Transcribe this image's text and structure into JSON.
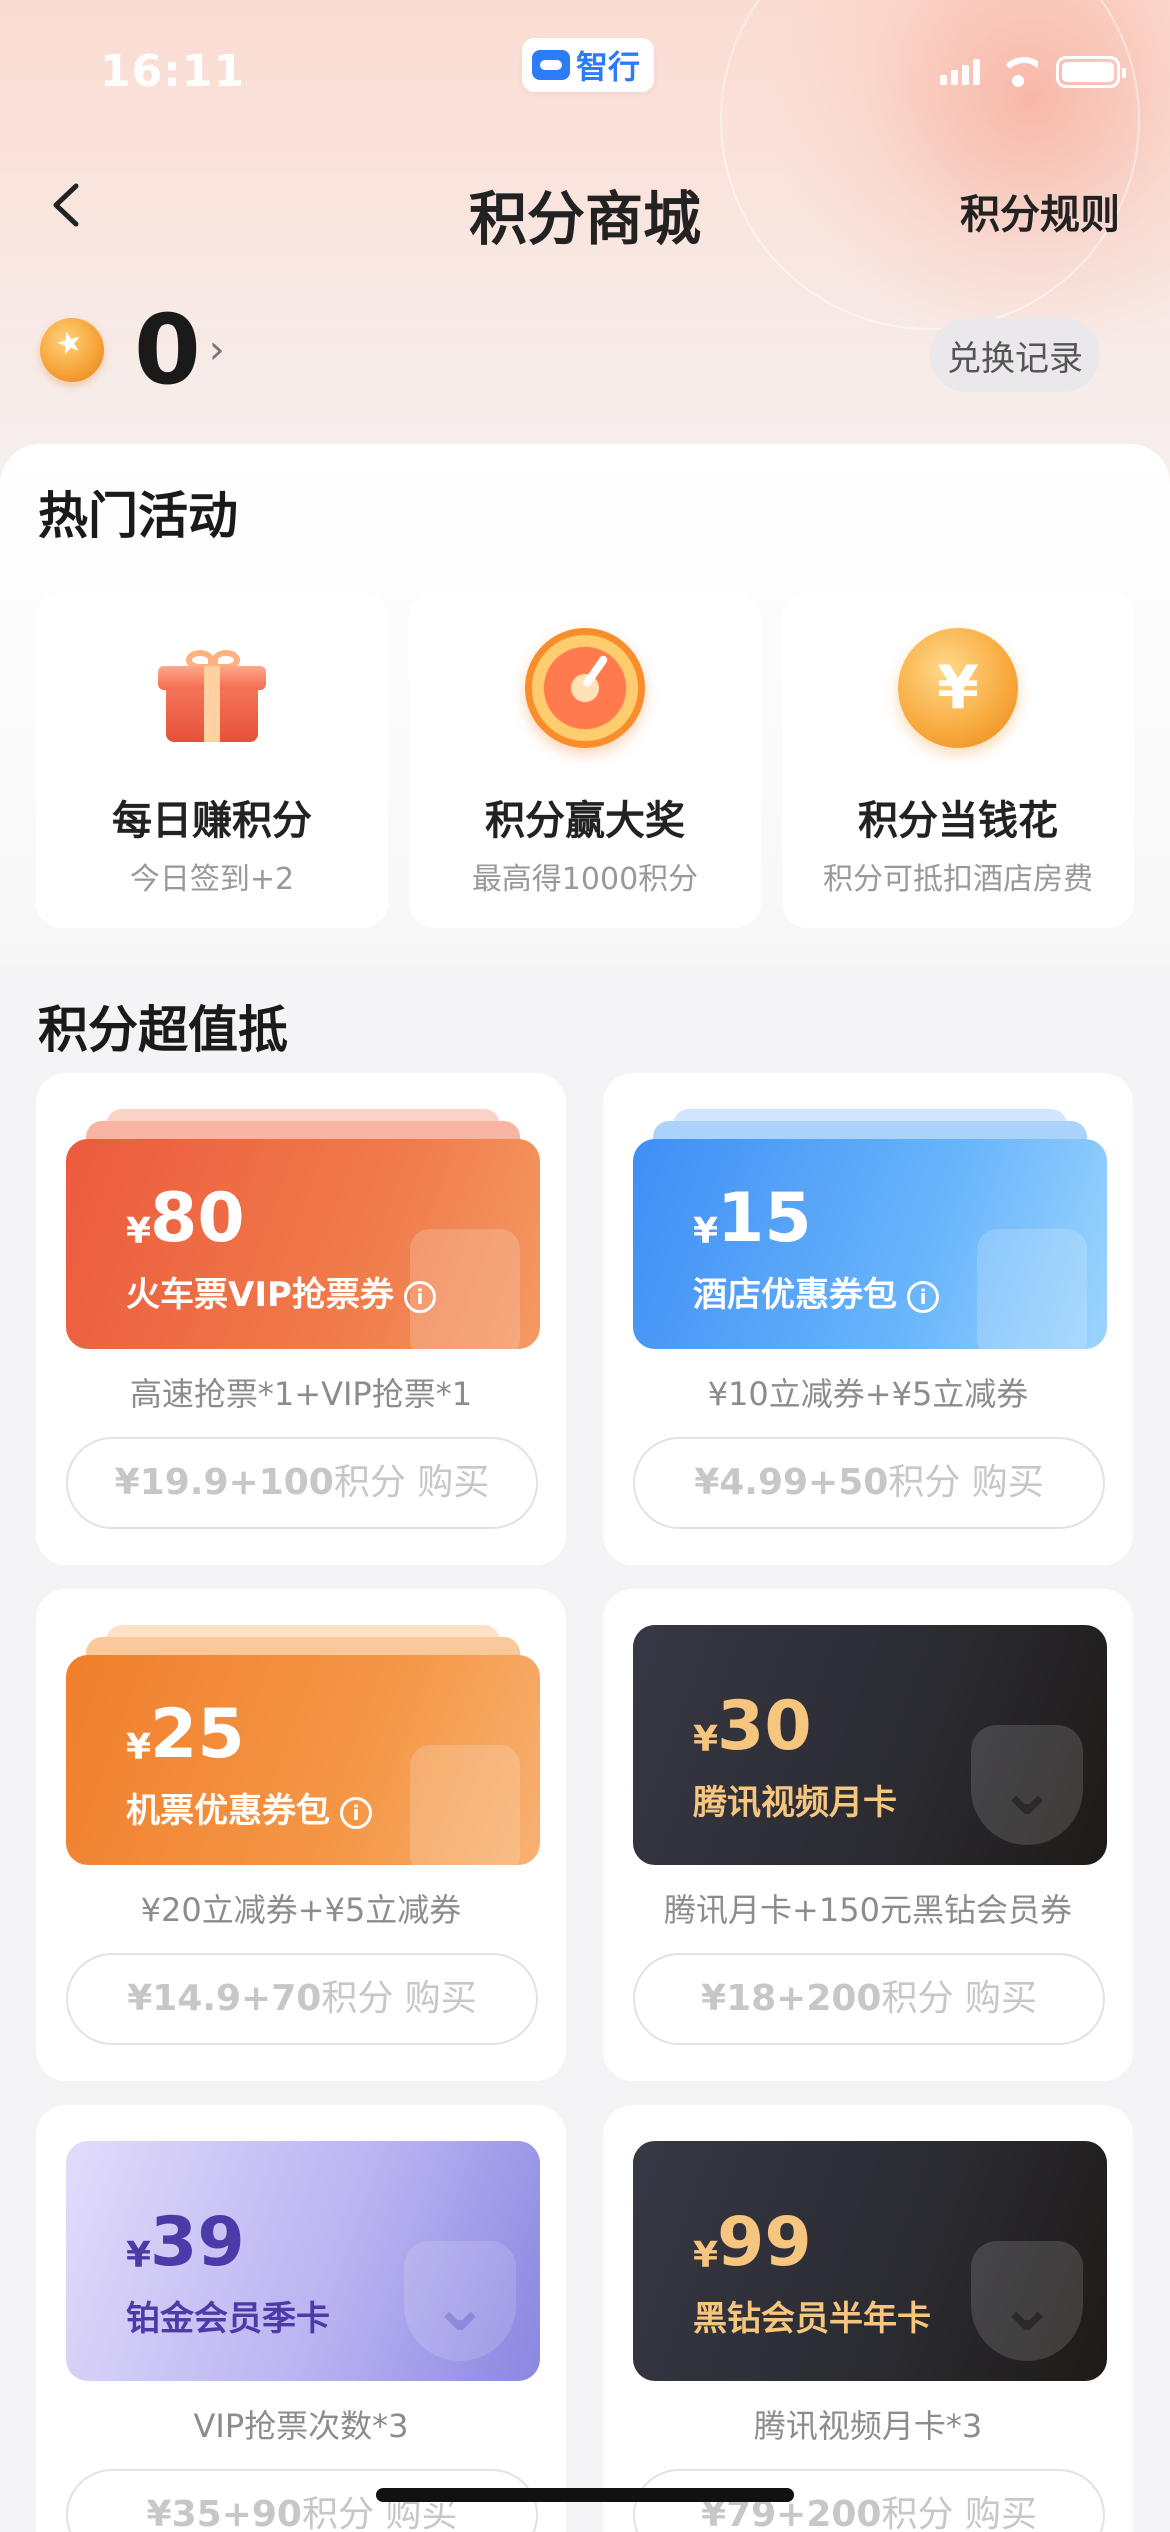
{
  "status_bar": {
    "time": "16:11",
    "app_name": "智行"
  },
  "nav": {
    "title": "积分商城",
    "rules": "积分规则"
  },
  "points": {
    "value": "0",
    "exchange_record": "兑换记录"
  },
  "hot_activities": {
    "title": "热门活动",
    "items": [
      {
        "title": "每日赚积分",
        "subtitle": "今日签到+2",
        "icon": "gift-icon"
      },
      {
        "title": "积分赢大奖",
        "subtitle": "最高得1000积分",
        "icon": "prize-wheel-icon"
      },
      {
        "title": "积分当钱花",
        "subtitle": "积分可抵扣酒店房费",
        "icon": "yen-coin-icon"
      }
    ]
  },
  "deals": {
    "title": "积分超值抵",
    "currency": "¥",
    "points_unit": "积分",
    "buy_label": "购买",
    "items": [
      {
        "amount": "80",
        "name": "火车票VIP抢票券",
        "info": "i",
        "desc": "高速抢票*1+VIP抢票*1",
        "price": "¥19.9+100",
        "style": "red"
      },
      {
        "amount": "15",
        "name": "酒店优惠券包",
        "info": "i",
        "desc": "¥10立减券+¥5立减券",
        "price": "¥4.99+50",
        "style": "blue"
      },
      {
        "amount": "25",
        "name": "机票优惠券包",
        "info": "i",
        "desc": "¥20立减券+¥5立减券",
        "price": "¥14.9+70",
        "style": "orange"
      },
      {
        "amount": "30",
        "name": "腾讯视频月卡",
        "desc": "腾讯月卡+150元黑钻会员券",
        "price": "¥18+200",
        "style": "dark"
      },
      {
        "amount": "39",
        "name": "铂金会员季卡",
        "desc": "VIP抢票次数*3",
        "price": "¥35+90",
        "style": "purple"
      },
      {
        "amount": "99",
        "name": "黑钻会员半年卡",
        "desc": "腾讯视频月卡*3",
        "price": "¥79+200",
        "style": "dark"
      }
    ]
  }
}
